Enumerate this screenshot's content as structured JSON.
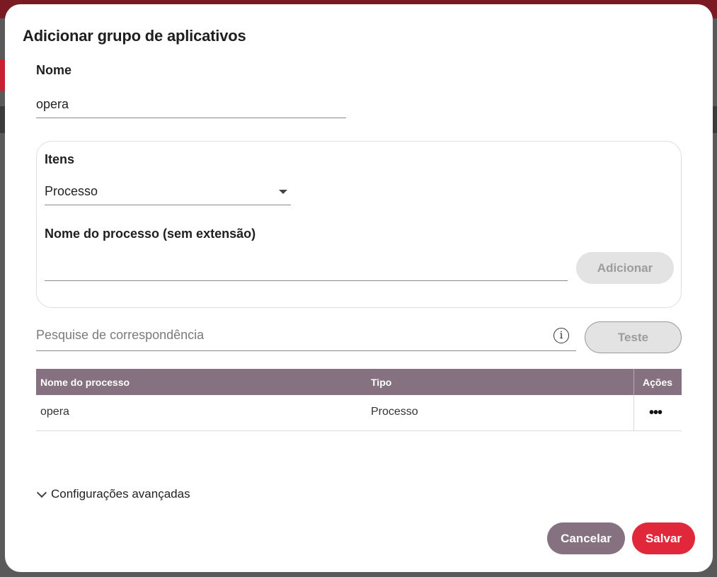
{
  "dialog": {
    "title": "Adicionar grupo de aplicativos"
  },
  "name_field": {
    "label": "Nome",
    "value": "opera"
  },
  "items": {
    "label": "Itens",
    "type_select": {
      "value": "Processo"
    },
    "process_name": {
      "label": "Nome do processo (sem extensão)",
      "value": ""
    },
    "add_button": "Adicionar"
  },
  "match_search": {
    "placeholder": "Pesquise de correspondência",
    "info_icon": "info-icon",
    "test_button": "Teste"
  },
  "table": {
    "headers": [
      "Nome do processo",
      "Tipo",
      "Ações"
    ],
    "rows": [
      {
        "name": "opera",
        "type": "Processo",
        "actions_icon": "more-horizontal-icon"
      }
    ]
  },
  "advanced": {
    "label": "Configurações avançadas",
    "icon": "chevron-down-icon"
  },
  "footer": {
    "cancel": "Cancelar",
    "save": "Salvar"
  },
  "colors": {
    "header_bg": "#85717f",
    "cancel_bg": "#85717f",
    "save_bg": "#e0283a",
    "disabled_bg": "#e3e3e3"
  }
}
